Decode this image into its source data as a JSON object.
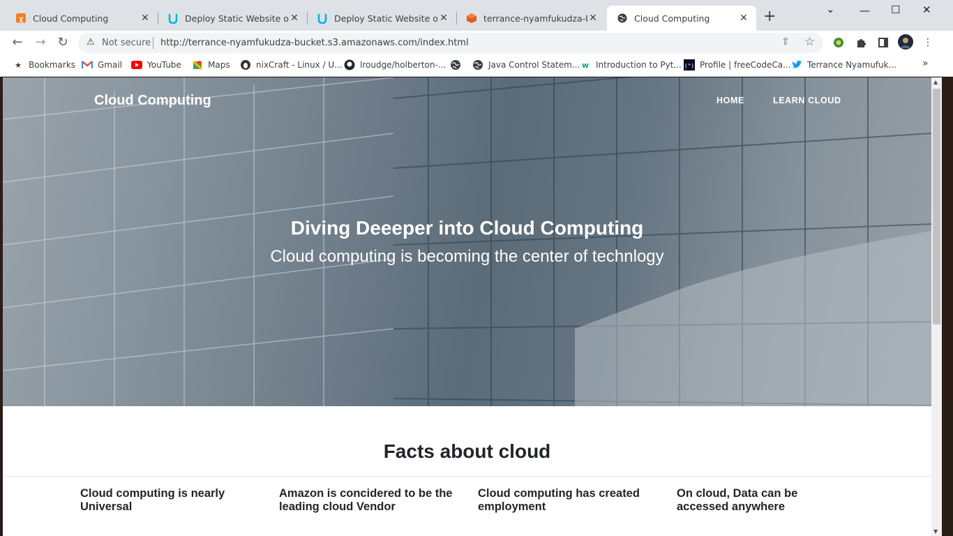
{
  "tabs": [
    {
      "title": "Cloud Computing",
      "icon": "xampp-icon",
      "active": false
    },
    {
      "title": "Deploy Static Website on AWS",
      "icon": "udacity-icon",
      "active": false
    },
    {
      "title": "Deploy Static Website on AWS",
      "icon": "udacity-icon",
      "active": false
    },
    {
      "title": "terrance-nyamfukudza-bucket",
      "icon": "aws-s3-icon",
      "active": false
    },
    {
      "title": "Cloud Computing",
      "icon": "globe-icon",
      "active": true
    }
  ],
  "address_bar": {
    "security_label": "Not secure",
    "url": "http://terrance-nyamfukudza-bucket.s3.amazonaws.com/index.html"
  },
  "bookmarks": [
    {
      "label": "Bookmarks",
      "icon": "star-icon"
    },
    {
      "label": "Gmail",
      "icon": "gmail-icon"
    },
    {
      "label": "YouTube",
      "icon": "youtube-icon"
    },
    {
      "label": "Maps",
      "icon": "maps-icon"
    },
    {
      "label": "nixCraft - Linux / U...",
      "icon": "nixcraft-icon"
    },
    {
      "label": "lroudge/holberton-...",
      "icon": "github-icon"
    },
    {
      "label": "",
      "icon": "globe-icon"
    },
    {
      "label": "Java Control Statem...",
      "icon": "globe-icon"
    },
    {
      "label": "Introduction to Pyt...",
      "icon": "w3-icon"
    },
    {
      "label": "Profile | freeCodeCa...",
      "icon": "freecodecamp-icon"
    },
    {
      "label": "Terrance Nyamufuk...",
      "icon": "twitter-icon"
    }
  ],
  "page": {
    "brand": "Cloud Computing",
    "nav": {
      "home": "HOME",
      "learn": "LEARN CLOUD"
    },
    "hero_title": "Diving Deeeper into Cloud Computing",
    "hero_subtitle": "Cloud computing is becoming the center of technlogy",
    "facts_heading": "Facts about cloud",
    "facts": [
      "Cloud computing is nearly Universal",
      "Amazon is concidered to be the leading cloud Vendor",
      "Cloud computing has created employment",
      "On cloud, Data can be accessed anywhere"
    ]
  },
  "colors": {
    "tab_strip": "#dee1e6",
    "text_dark": "#212529",
    "hero_text": "#ffffff"
  }
}
